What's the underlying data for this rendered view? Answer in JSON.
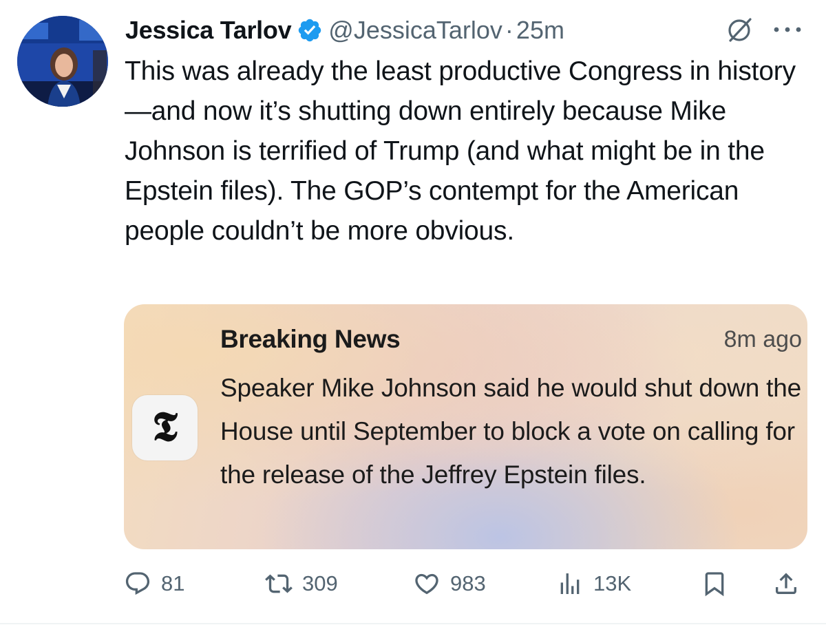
{
  "tweet": {
    "author": {
      "display_name": "Jessica Tarlov",
      "handle": "@JessicaTarlov",
      "verified_icon": "verified-badge-icon"
    },
    "separator": "·",
    "timestamp": "25m",
    "text": "This was already the least productive Congress in history—and now it’s shutting down entirely because Mike Johnson is terrified of Trump (and what might be in the Epstein files). The GOP’s contempt for the American people couldn’t be more obvious.",
    "header_icons": [
      "grok-icon",
      "more-icon"
    ]
  },
  "quote_card": {
    "app_icon_glyph": "𝕿",
    "app_icon_name": "nyt-app-icon",
    "title": "Breaking News",
    "time": "8m ago",
    "body": "Speaker Mike Johnson said he would shut down the House until September to block a vote on calling for the release of the Jeffrey Epstein files."
  },
  "actions": {
    "replies": "81",
    "reposts": "309",
    "likes": "983",
    "views": "13K",
    "icons": [
      "reply-icon",
      "repost-icon",
      "like-icon",
      "views-icon",
      "bookmark-icon",
      "share-icon"
    ]
  },
  "colors": {
    "text": "#0f1419",
    "secondary": "#536471",
    "verified": "#1d9bf0"
  }
}
